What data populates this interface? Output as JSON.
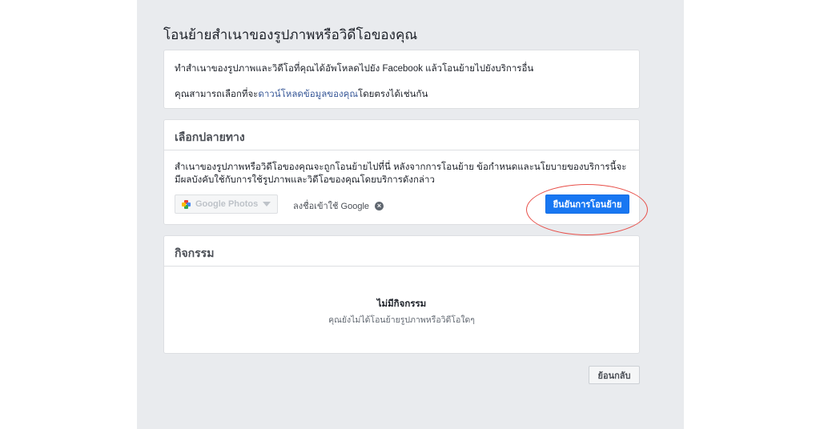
{
  "page": {
    "title": "โอนย้ายสำเนาของรูปภาพหรือวิดีโอของคุณ"
  },
  "intro": {
    "line1": "ทำสำเนาของรูปภาพและวิดีโอที่คุณได้อัพโหลดไปยัง Facebook แล้วโอนย้ายไปยังบริการอื่น",
    "line2_prefix": "คุณสามารถเลือกที่จะ",
    "line2_link": "ดาวน์โหลดข้อมูลของคุณ",
    "line2_suffix": "โดยตรงได้เช่นกัน"
  },
  "destination": {
    "header": "เลือกปลายทาง",
    "description": "สำเนาของรูปภาพหรือวิดีโอของคุณจะถูกโอนย้ายไปที่นี่ หลังจากการโอนย้าย ข้อกำหนดและนโยบายของบริการนี้จะมีผลบังคับใช้กับการใช้รูปภาพและวิดีโอของคุณโดยบริการดังกล่าว",
    "provider": "Google Photos",
    "signed_in_label": "ลงชื่อเข้าใช้ Google",
    "confirm_label": "ยืนยันการโอนย้าย"
  },
  "activity": {
    "header": "กิจกรรม",
    "empty_title": "ไม่มีกิจกรรม",
    "empty_subtitle": "คุณยังไม่ได้โอนย้ายรูปภาพหรือวิดีโอใดๆ"
  },
  "footer": {
    "back_label": "ย้อนกลับ"
  },
  "colors": {
    "background": "#e9ebee",
    "primary_button": "#1877f2",
    "link": "#385898",
    "highlight": "#e8504a"
  },
  "icons": {
    "provider_icon": "google-photos-pinwheel-icon",
    "dropdown": "caret-down-icon",
    "clear": "clear-x-icon"
  }
}
